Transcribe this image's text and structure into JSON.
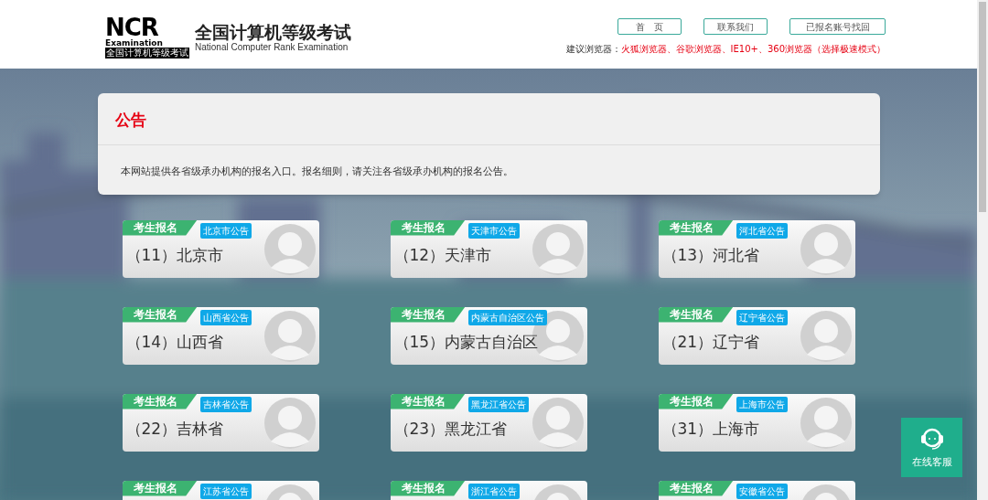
{
  "header": {
    "logo": {
      "mark": "NCR",
      "caption": "Examination",
      "subcaption": "全国计算机等级考试"
    },
    "title": "全国计算机等级考试",
    "subtitle": "National Computer Rank Examination",
    "nav": [
      "首　页",
      "联系我们",
      "已报名账号找回"
    ],
    "browser_hint": {
      "label": "建议浏览器：",
      "value": "火狐浏览器、谷歌浏览器、IE10+、360浏览器（选择极速模式）"
    }
  },
  "notice": {
    "title": "公告",
    "text": "本网站提供各省级承办机构的报名入口。报名细则，请关注各省级承办机构的报名公告。"
  },
  "regions": [
    {
      "ribbon": "考生报名",
      "badge": "北京市公告",
      "name": "（11）北京市"
    },
    {
      "ribbon": "考生报名",
      "badge": "天津市公告",
      "name": "（12）天津市"
    },
    {
      "ribbon": "考生报名",
      "badge": "河北省公告",
      "name": "（13）河北省"
    },
    {
      "ribbon": "考生报名",
      "badge": "山西省公告",
      "name": "（14）山西省"
    },
    {
      "ribbon": "考生报名",
      "badge": "内蒙古自治区公告",
      "name": "（15）内蒙古自治区"
    },
    {
      "ribbon": "考生报名",
      "badge": "辽宁省公告",
      "name": "（21）辽宁省"
    },
    {
      "ribbon": "考生报名",
      "badge": "吉林省公告",
      "name": "（22）吉林省"
    },
    {
      "ribbon": "考生报名",
      "badge": "黑龙江省公告",
      "name": "（23）黑龙江省"
    },
    {
      "ribbon": "考生报名",
      "badge": "上海市公告",
      "name": "（31）上海市"
    },
    {
      "ribbon": "考生报名",
      "badge": "江苏省公告"
    },
    {
      "ribbon": "考生报名",
      "badge": "浙江省公告"
    },
    {
      "ribbon": "考生报名",
      "badge": "安徽省公告"
    }
  ],
  "service_button": {
    "label": "在线客服"
  }
}
